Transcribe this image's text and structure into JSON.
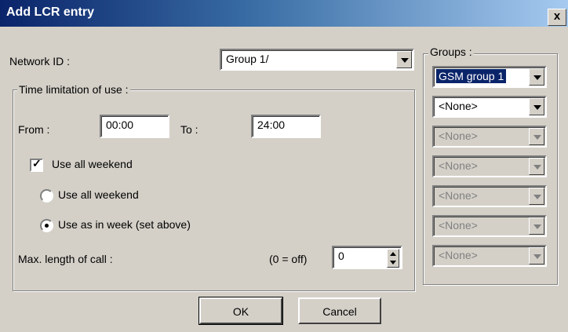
{
  "window": {
    "title": "Add LCR entry",
    "close_label": "x"
  },
  "network": {
    "label": "Network ID :",
    "value": "Group 1/"
  },
  "time_group": {
    "title": "Time limitation of use :",
    "from_label": "From :",
    "from_value": "00:00",
    "to_label": "To :",
    "to_value": "24:00",
    "weekend_checkbox": "Use all weekend",
    "weekend_checked": true,
    "radio_all_weekend": "Use all weekend",
    "radio_as_week": "Use as in week (set above)",
    "selected_radio": "as_week",
    "max_length_label": "Max. length of call :",
    "off_hint": "(0 = off)",
    "max_length_value": "0"
  },
  "groups": {
    "title": "Groups :",
    "items": [
      {
        "value": "GSM group 1",
        "enabled": true,
        "highlighted": true
      },
      {
        "value": "<None>",
        "enabled": true,
        "highlighted": false
      },
      {
        "value": "<None>",
        "enabled": false,
        "highlighted": false
      },
      {
        "value": "<None>",
        "enabled": false,
        "highlighted": false
      },
      {
        "value": "<None>",
        "enabled": false,
        "highlighted": false
      },
      {
        "value": "<None>",
        "enabled": false,
        "highlighted": false
      },
      {
        "value": "<None>",
        "enabled": false,
        "highlighted": false
      }
    ]
  },
  "buttons": {
    "ok": "OK",
    "cancel": "Cancel"
  },
  "colors": {
    "titlebar_start": "#0a246a",
    "titlebar_end": "#a6caf0",
    "dialog_bg": "#d4d0c8",
    "selection": "#0a246a"
  }
}
